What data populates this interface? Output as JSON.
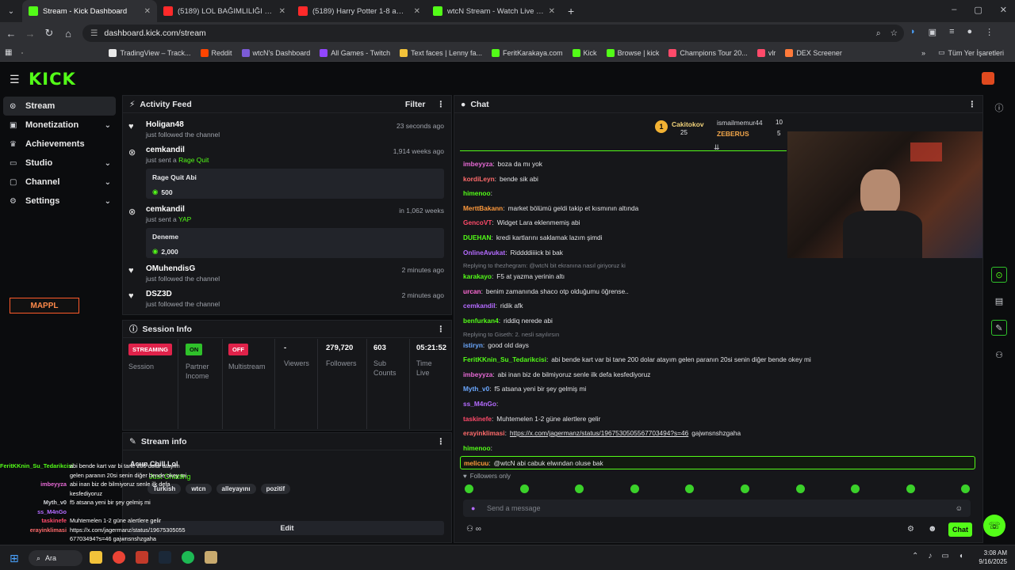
{
  "browser": {
    "tabs": [
      {
        "title": "Stream - Kick Dashboard",
        "color": "#53fc18",
        "active": true
      },
      {
        "title": "(5189) LOL BAĞIMLILIĞI 1.5 - Yo",
        "color": "#ff2a2a",
        "active": false
      },
      {
        "title": "(5189) Harry Potter 1-8 ama Tw",
        "color": "#ff2a2a",
        "active": false
      },
      {
        "title": "wtcN Stream - Watch Live on Ki",
        "color": "#53fc18",
        "active": false
      }
    ],
    "url": "dashboard.kick.com/stream",
    "bookmarks": [
      "TradingView – Track...",
      "Reddit",
      "wtcN's Dashboard",
      "All Games - Twitch",
      "Text faces | Lenny fa...",
      "FeritKarakaya.com",
      "Kick",
      "Browse | kick",
      "Champions Tour 20...",
      "vlr",
      "DEX Screener"
    ],
    "bookmarks_folder": "Tüm Yer İşaretleri"
  },
  "brand": {
    "logo": "KICK"
  },
  "sidebar": {
    "items": [
      {
        "label": "Stream",
        "icon": "broadcast-icon",
        "active": true,
        "expandable": false
      },
      {
        "label": "Monetization",
        "icon": "money-icon",
        "active": false,
        "expandable": true
      },
      {
        "label": "Achievements",
        "icon": "trophy-icon",
        "active": false,
        "expandable": false
      },
      {
        "label": "Studio",
        "icon": "studio-icon",
        "active": false,
        "expandable": true
      },
      {
        "label": "Channel",
        "icon": "channel-icon",
        "active": false,
        "expandable": true
      },
      {
        "label": "Settings",
        "icon": "gear-icon",
        "active": false,
        "expandable": true
      }
    ]
  },
  "activity": {
    "title": "Activity Feed",
    "filter": "Filter",
    "items": [
      {
        "name": "Holigan48",
        "sub": "just followed the channel",
        "time": "23 seconds ago"
      },
      {
        "name": "cemkandil",
        "sub": "just sent a",
        "gift": "Rage Quit",
        "time": "1,914 weeks ago",
        "card_title": "Rage Quit Abi",
        "amount": "500"
      },
      {
        "name": "cemkandil",
        "sub": "just sent a",
        "gift": "YAP",
        "time": "in 1,062 weeks",
        "card_title": "Deneme",
        "amount": "2,000"
      },
      {
        "name": "OMuhendisG",
        "sub": "just followed the channel",
        "time": "2 minutes ago"
      },
      {
        "name": "DSZ3D",
        "sub": "just followed the channel",
        "time": "2 minutes ago"
      }
    ]
  },
  "session": {
    "title": "Session Info",
    "streaming": "STREAMING",
    "session_label": "Session",
    "partner_state": "ON",
    "partner_label": "Partner Income",
    "multistream_state": "OFF",
    "multistream_label": "Multistream",
    "viewers": "-",
    "viewers_label": "Viewers",
    "followers": "279,720",
    "followers_label": "Followers",
    "subs": "603",
    "subs_label": "Sub Counts",
    "time": "05:21:52",
    "time_label": "Time Live"
  },
  "stream_info": {
    "title": "Stream info",
    "tags": [
      "Turkish",
      "wtcn",
      "alleyayını",
      "pozitif"
    ],
    "edit": "Edit",
    "stream_title": "Acun Chill Lol",
    "category": "Just Chatting"
  },
  "chat": {
    "title": "Chat",
    "leaders": [
      {
        "rank": "1",
        "name": "Cakitokov",
        "count": "25"
      },
      {
        "name": "ismailmemur44",
        "count": "10"
      },
      {
        "name": "ZEBERUS",
        "count": "5"
      }
    ],
    "lines": [
      {
        "user": "imbeyyza",
        "color": "#e86ad6",
        "text": "boza da mı yok"
      },
      {
        "user": "kordiLeyn",
        "color": "#ff6b6b",
        "text": "bende sik abi"
      },
      {
        "user": "himenoo",
        "color": "#53fc18",
        "text": ""
      },
      {
        "user": "MerttBakann",
        "color": "#ff9a3d",
        "text": "market bölümü geldi takip et kısmının altında"
      },
      {
        "user": "GencoVT",
        "color": "#ff4a6a",
        "text": "Widget Lara eklenmemiş abi"
      },
      {
        "user": "DUEHAN",
        "color": "#53fc18",
        "text": "kredi kartlarını saklamak lazım şimdi"
      },
      {
        "user": "OnlineAvukat",
        "color": "#b46bff",
        "text": "Riddddiiiick bi bak"
      },
      {
        "reply": "Replying to thezhegram: @wtcN bit ekranına nasıl giriyoruz ki"
      },
      {
        "user": "karakayo",
        "color": "#53fc18",
        "text": "F5 at yazma yerinin altı"
      },
      {
        "user": "urcan",
        "color": "#ff6bd6",
        "text": "benim zamanında shaco otp olduğumu öğrense.."
      },
      {
        "user": "cemkandil",
        "color": "#b46bff",
        "text": "ridik afk"
      },
      {
        "user": "benfurkan4",
        "color": "#53fc18",
        "text": "riddiq nerede abi"
      },
      {
        "reply": "Replying to Giseth: 2. nesli sayılırsın"
      },
      {
        "user": "istiryn",
        "color": "#6ba8ff",
        "text": "good old days"
      },
      {
        "user": "FeritKKnin_Su_Tedarikcisi",
        "color": "#53fc18",
        "text": "abi bende kart var bi tane 200 dolar atayım gelen paranın 20si senin diğer bende okey mi"
      },
      {
        "user": "imbeyyza",
        "color": "#e86ad6",
        "text": "abi inan biz de bilmiyoruz senle ilk defa kesfediyoruz"
      },
      {
        "user": "Myth_v0",
        "color": "#6ba8ff",
        "text": "f5 atsana yeni bir şey gelmiş mi"
      },
      {
        "user": "ss_M4nGo",
        "color": "#b46bff",
        "text": ""
      },
      {
        "user": "taskinefe",
        "color": "#ff4a6a",
        "text": "Muhtemelen 1-2 güne alertlere gelir"
      },
      {
        "user": "erayinklimasi",
        "color": "#ff6b6b",
        "text": "https://x.com/jagermanz/status/1967530505567703494?s=46",
        "text2": "gajwnsnshzgaha"
      },
      {
        "user": "himenoo",
        "color": "#53fc18",
        "text": ""
      },
      {
        "user": "melicuu",
        "color": "#ff9a3d",
        "text": "@wtcN abi cabuk elwından oluse bak",
        "highlight": true
      }
    ],
    "followers_only": "Followers only",
    "placeholder": "Send a message",
    "send": "Chat"
  },
  "overlay": {
    "lines": [
      {
        "user": "FeritKKnin_Su_Tedarikcisi",
        "color": "#53fc18",
        "text": "abi bende kart var bi tane 200 dolar atayım"
      },
      {
        "user": "",
        "color": "",
        "text": "gelen paranın 20si senin diğer bende okey mi"
      },
      {
        "user": "imbeyyza",
        "color": "#e86ad6",
        "text": "abi inan biz de bilmiyoruz senle ilk defa"
      },
      {
        "user": "",
        "color": "",
        "text": "kesfediyoruz"
      },
      {
        "user": "Myth_v0",
        "color": "#cfd1d6",
        "text": "f5 atsana yeni bir şey gelmiş mi"
      },
      {
        "user": "ss_M4nGo",
        "color": "#b46bff",
        "text": ""
      },
      {
        "user": "taskinefe",
        "color": "#ff4a6a",
        "text": "Muhtemelen 1-2 güne alertlere gelir"
      },
      {
        "user": "erayinklimasi",
        "color": "#ff6b6b",
        "text": "https://x.com/jagermanz/status/19675305055"
      },
      {
        "user": "",
        "color": "",
        "text": "67703494?s=46 gajwnsnshzgaha"
      },
      {
        "user": "himenoo",
        "color": "#53fc18",
        "text": ""
      }
    ]
  },
  "taskbar": {
    "search": "Ara",
    "time": "3:08 AM",
    "date": "9/16/2025"
  }
}
